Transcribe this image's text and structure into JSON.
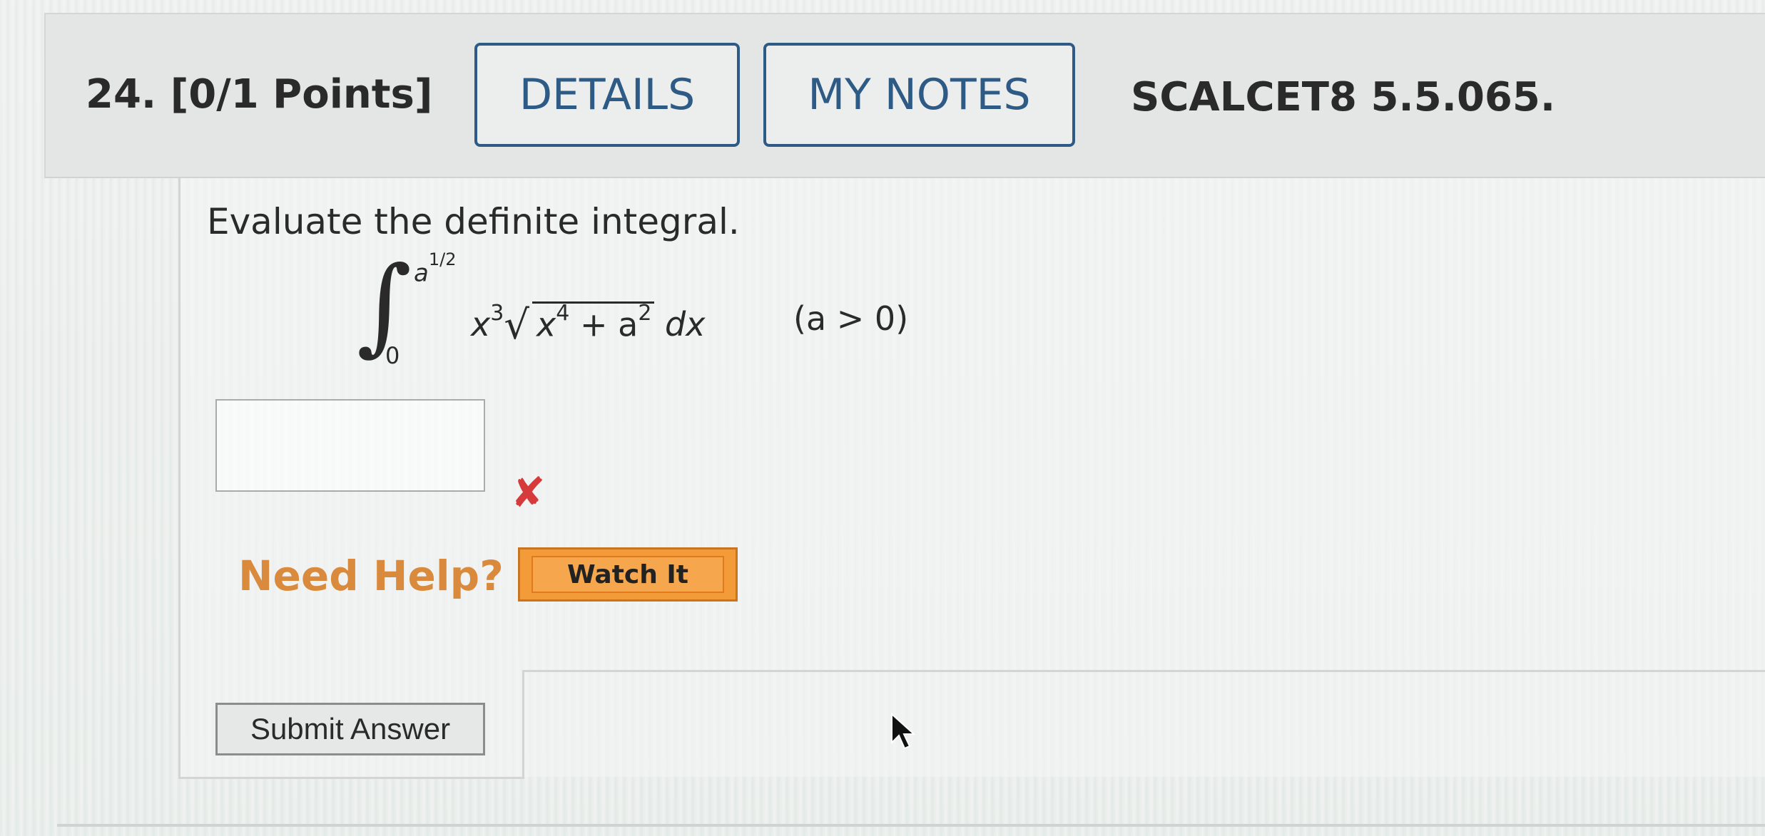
{
  "question": {
    "number_label": "24.",
    "points": "[0/1 Points]",
    "details_label": "DETAILS",
    "notes_label": "MY NOTES",
    "reference": "SCALCET8 5.5.065."
  },
  "problem": {
    "prompt": "Evaluate the definite integral.",
    "integral": {
      "upper_limit": "a",
      "upper_exponent": "1/2",
      "lower_limit": "0",
      "x_base": "x",
      "x_power": "3",
      "radicand_x": "x",
      "radicand_x_power": "4",
      "radicand_plus": "+ a",
      "radicand_a_power": "2",
      "differential": "dx",
      "condition": "(a > 0)"
    }
  },
  "answer": {
    "value": "",
    "status": "incorrect",
    "status_icon": "x-mark-icon",
    "status_color": "#d63b3b"
  },
  "help": {
    "label": "Need Help?",
    "watch_label": "Watch It",
    "color": "#d98a3c",
    "button_color": "#f29b38"
  },
  "actions": {
    "submit_label": "Submit Answer"
  },
  "colors": {
    "accent": "#2e5a86"
  }
}
